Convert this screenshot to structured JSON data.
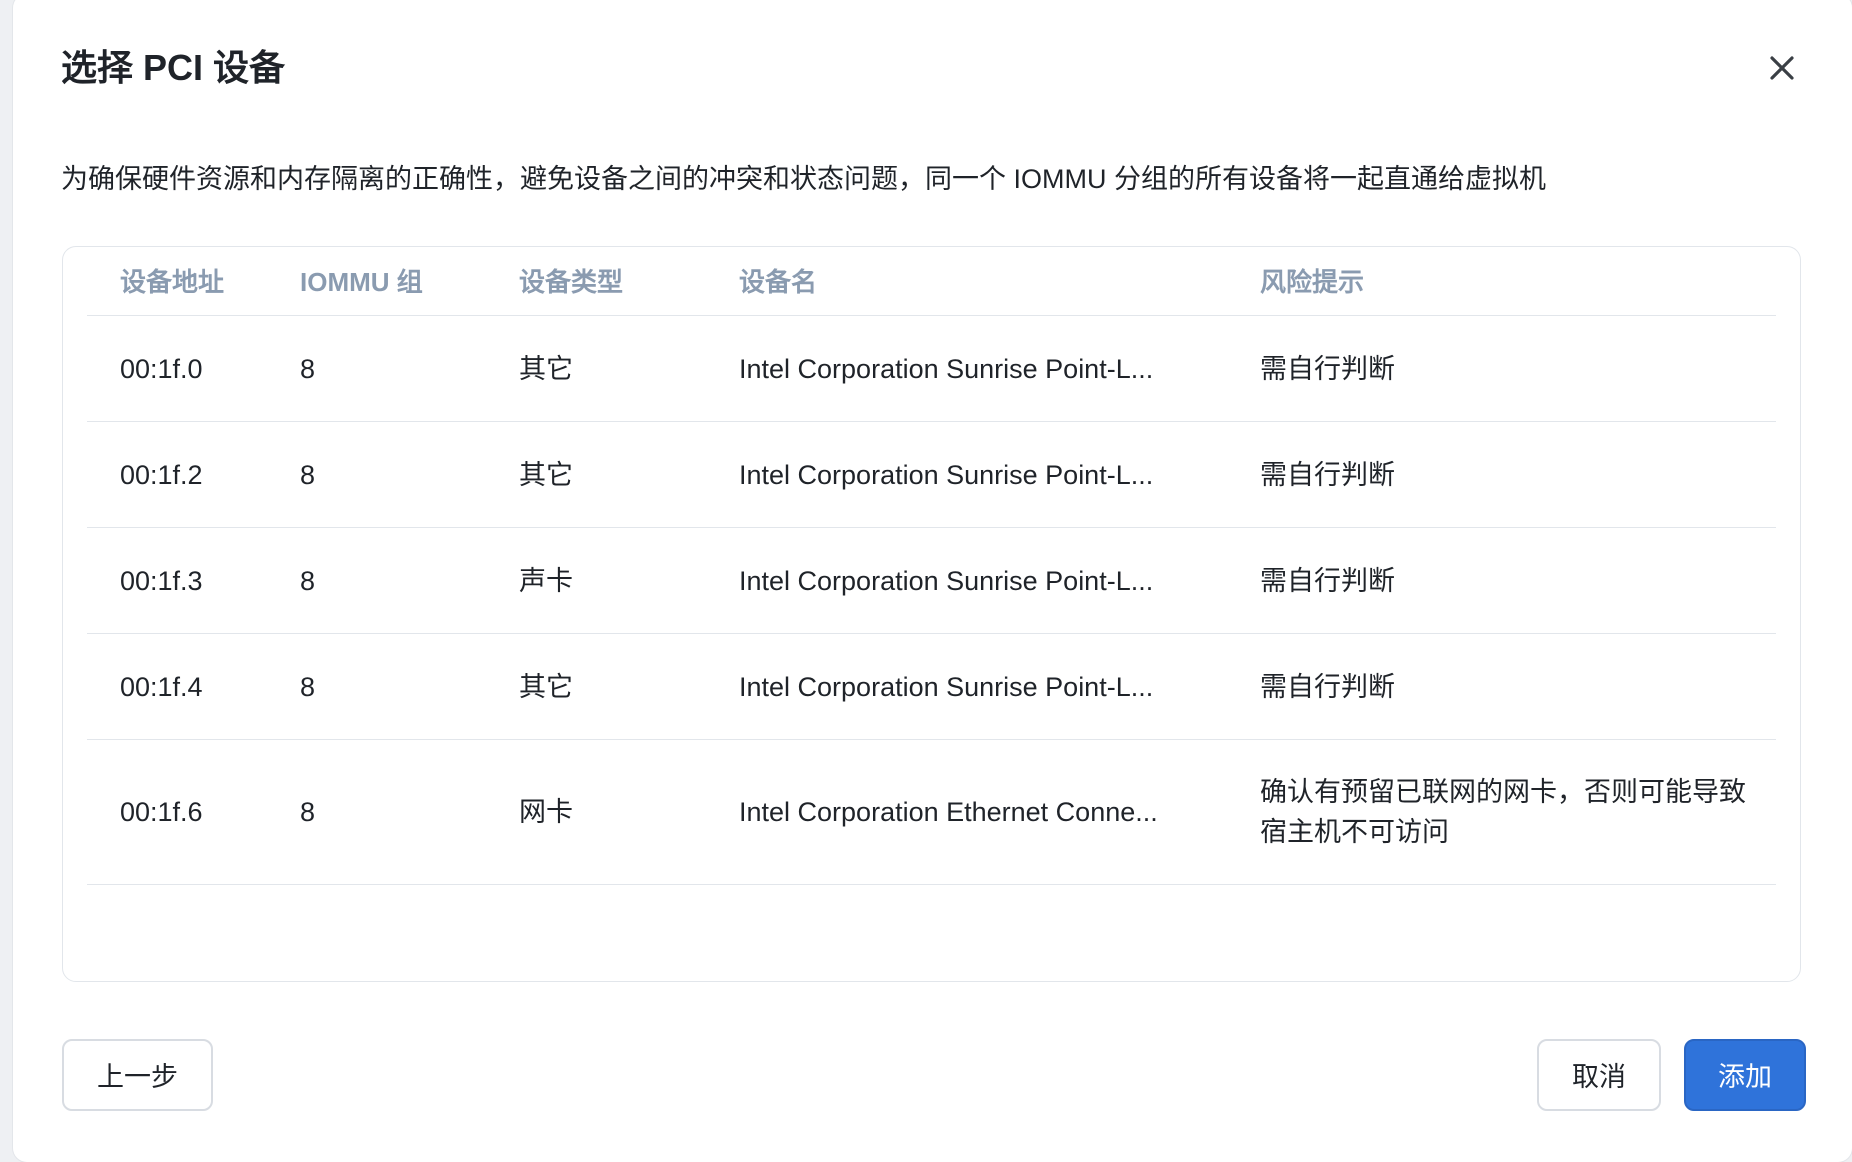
{
  "dialog": {
    "title": "选择 PCI 设备",
    "description": "为确保硬件资源和内存隔离的正确性，避免设备之间的冲突和状态问题，同一个 IOMMU 分组的所有设备将一起直通给虚拟机",
    "close_icon": "close-icon"
  },
  "table": {
    "headers": [
      "设备地址",
      "IOMMU 组",
      "设备类型",
      "设备名",
      "风险提示"
    ],
    "rows": [
      {
        "address": "00:1f.0",
        "group": "8",
        "type": "其它",
        "name": "Intel Corporation Sunrise Point-L...",
        "risk": "需自行判断"
      },
      {
        "address": "00:1f.2",
        "group": "8",
        "type": "其它",
        "name": "Intel Corporation Sunrise Point-L...",
        "risk": "需自行判断"
      },
      {
        "address": "00:1f.3",
        "group": "8",
        "type": "声卡",
        "name": "Intel Corporation Sunrise Point-L...",
        "risk": "需自行判断"
      },
      {
        "address": "00:1f.4",
        "group": "8",
        "type": "其它",
        "name": "Intel Corporation Sunrise Point-L...",
        "risk": "需自行判断"
      },
      {
        "address": "00:1f.6",
        "group": "8",
        "type": "网卡",
        "name": "Intel Corporation Ethernet Conne...",
        "risk": "确认有预留已联网的网卡，否则可能导致宿主机不可访问"
      }
    ]
  },
  "footer": {
    "prev_label": "上一步",
    "cancel_label": "取消",
    "add_label": "添加"
  },
  "colors": {
    "primary": "#2f73da",
    "header_text": "#8a9bb0",
    "border": "#e2e6eb"
  }
}
